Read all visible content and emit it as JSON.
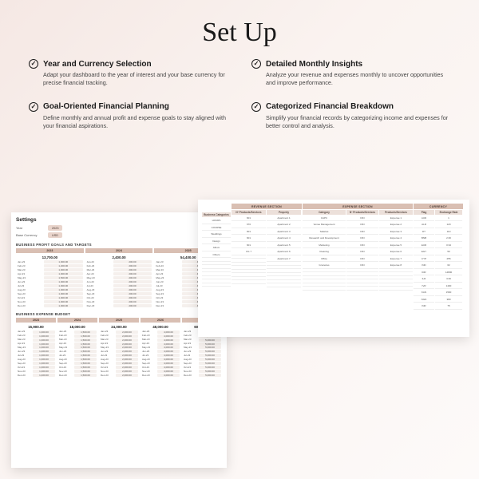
{
  "title": "Set Up",
  "features": [
    {
      "heading": "Year and Currency Selection",
      "desc": "Adapt your dashboard to the year of interest and your base currency for precise financial tracking."
    },
    {
      "heading": "Detailed Monthly Insights",
      "desc": "Analyze your revenue and expenses monthly to uncover opportunities and improve performance."
    },
    {
      "heading": "Goal-Oriented Financial Planning",
      "desc": "Define monthly and annual profit and expense goals to stay aligned with your financial aspirations."
    },
    {
      "heading": "Categorized Financial Breakdown",
      "desc": "Simplify your financial records by categorizing income and expenses for better control and analysis."
    }
  ],
  "settings": {
    "title": "Settings",
    "year_label": "Year",
    "year_value": "2023",
    "currency_label": "Base Currency",
    "currency_value": "USD",
    "goals_section": "BUSINESS PROFIT GOALS AND TARGETS",
    "budget_section": "BUSINESS EXPENSE BUDGET",
    "months": [
      "Jan-23",
      "Feb-23",
      "Mar-23",
      "Apr-23",
      "May-23",
      "Jun-23",
      "Jul-23",
      "Aug-23",
      "Sep-23",
      "Oct-23",
      "Nov-23",
      "Dec-23"
    ],
    "goals": {
      "years": [
        "2023",
        "2024",
        "2025"
      ],
      "totals": [
        "13,700.00",
        "2,400.00",
        "54,400.00"
      ],
      "samples": [
        [
          "1,000.00",
          "1,200.00",
          "1,000.00",
          "1,000.00",
          "1,500.00",
          "1,000.00",
          "1,000.00",
          "1,000.00",
          "1,000.00",
          "1,000.00",
          "1,000.00",
          "1,000.00"
        ],
        [
          "200.00",
          "200.00",
          "200.00",
          "200.00",
          "200.00",
          "200.00",
          "200.00",
          "200.00",
          "200.00",
          "200.00",
          "200.00",
          "200.00"
        ],
        [
          "4,500.00",
          "4,500.00",
          "4,500.00",
          "4,500.00",
          "4,500.00",
          "4,600.00",
          "4,500.00",
          "4,500.00",
          "4,500.00",
          "4,500.00",
          "4,500.00",
          "4,800.00"
        ]
      ]
    },
    "budget": {
      "years": [
        "2023",
        "2024",
        "2025",
        "2026",
        "2027"
      ],
      "totals": [
        "15,900.00",
        "18,000.00",
        "24,000.00",
        "48,000.00",
        "60,000.00"
      ],
      "samples": [
        [
          "1,300.00",
          "1,300.00",
          "1,300.00",
          "1,300.00",
          "1,300.00",
          "1,400.00",
          "1,300.00",
          "1,300.00",
          "1,300.00",
          "1,300.00",
          "1,300.00",
          "1,400.00"
        ],
        [
          "1,500.00",
          "1,500.00",
          "1,500.00",
          "1,500.00",
          "1,500.00",
          "1,500.00",
          "1,500.00",
          "1,500.00",
          "1,500.00",
          "1,500.00",
          "1,500.00",
          "1,500.00"
        ],
        [
          "2,000.00",
          "2,000.00",
          "2,000.00",
          "2,000.00",
          "2,000.00",
          "2,000.00",
          "2,000.00",
          "2,000.00",
          "2,000.00",
          "2,000.00",
          "2,000.00",
          "2,000.00"
        ],
        [
          "4,000.00",
          "4,000.00",
          "4,000.00",
          "4,000.00",
          "4,000.00",
          "4,000.00",
          "4,000.00",
          "4,000.00",
          "4,000.00",
          "4,000.00",
          "4,000.00",
          "4,000.00"
        ],
        [
          "5,000.00",
          "5,000.00",
          "5,000.00",
          "5,000.00",
          "5,000.00",
          "5,000.00",
          "5,000.00",
          "5,000.00",
          "5,000.00",
          "5,000.00",
          "5,000.00",
          "5,000.00"
        ]
      ]
    }
  },
  "breakdown": {
    "row_labels": [
      "HOURS",
      "COURSE",
      "Weddings",
      "Design",
      "Album",
      "Others",
      "",
      "",
      "",
      "",
      "",
      "",
      "",
      ""
    ],
    "revenue_section": "REVENUE SECTION",
    "expense_section": "EXPENSE SECTION",
    "currency_section": "CURRENCY",
    "cols": {
      "row_head": "Business Categories",
      "products": {
        "head": "Nº Products/Services",
        "cells": [
          "601",
          "670",
          "601",
          "601",
          "601",
          "CG 7",
          "",
          "",
          "",
          "",
          "",
          "",
          "",
          ""
        ]
      },
      "property": {
        "head": "Property",
        "cells": [
          "Apartment 1",
          "Apartment 2",
          "Apartment 3",
          "Apartment 4",
          "Apartment 5",
          "Apartment 6",
          "Apartment 7",
          "",
          "",
          "",
          "",
          "",
          "",
          ""
        ]
      },
      "category": {
        "head": "Category",
        "cells": [
          "CAPC",
          "Venue Management",
          "Salaries",
          "Research and Development",
          "Marketing",
          "Cleaning",
          "Office",
          "Groceries",
          "",
          "",
          "",
          "",
          "",
          ""
        ]
      },
      "exp_products": {
        "head": "Nº Products/Services",
        "cells": [
          "DIN",
          "DIN",
          "DIN",
          "DIN",
          "DIN",
          "DIN",
          "DIN",
          "DIN",
          "",
          "",
          "",
          "",
          "",
          ""
        ]
      },
      "product": {
        "head": "Products/Services",
        "cells": [
          "Expense 1",
          "Expense 2",
          "Expense 3",
          "Expense 4",
          "Expense 5",
          "Expense 6",
          "Expense 7",
          "Expense 8",
          "",
          "",
          "",
          "",
          "",
          ""
        ]
      },
      "flag": {
        "head": "Flag",
        "cells": [
          "AUD",
          "ALR",
          "DT",
          "BNB",
          "EUR",
          "EGY",
          "CYP",
          "IND",
          "IDR",
          "ILR",
          "IVR",
          "KAN",
          "NGN",
          "INR"
        ]
      },
      "rate": {
        "head": "Exchange Rate",
        "cells": [
          "1",
          "120",
          "110",
          "2.60",
          "0.94",
          "50",
          "255",
          "62",
          "14800",
          "3.60",
          "1400",
          "1500",
          "380",
          "75"
        ]
      }
    }
  }
}
